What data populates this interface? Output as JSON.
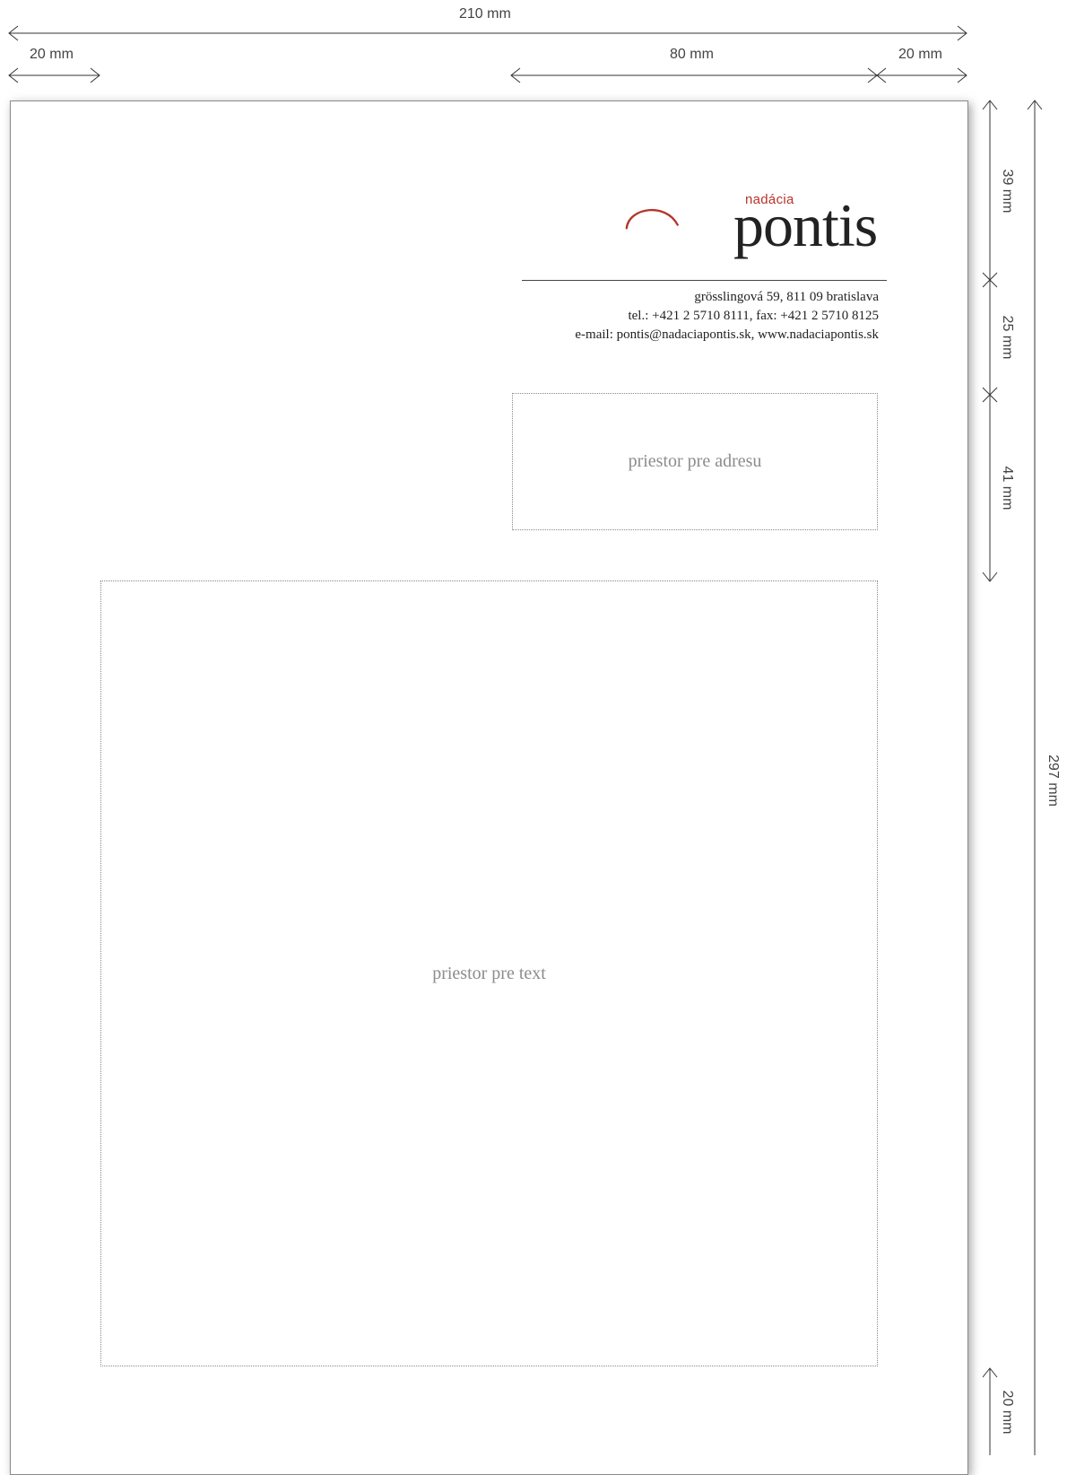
{
  "dimensions": {
    "page_width": "210 mm",
    "left_margin": "20 mm",
    "right_block_width": "80 mm",
    "right_margin": "20 mm",
    "header_height": "39 mm",
    "contact_height": "25 mm",
    "address_height": "41 mm",
    "bottom_margin": "20 mm",
    "page_height": "297 mm"
  },
  "logo": {
    "small": "nadácia",
    "big": "pontis",
    "arc_color": "#b5342a"
  },
  "contact": {
    "line1": "grösslingová 59, 811 09 bratislava",
    "line2": "tel.: +421 2 5710 8111, fax: +421 2 5710 8125",
    "line3": "e-mail: pontis@nadaciapontis.sk, www.nadaciapontis.sk"
  },
  "placeholders": {
    "address": "priestor pre adresu",
    "text": "priestor pre text"
  }
}
